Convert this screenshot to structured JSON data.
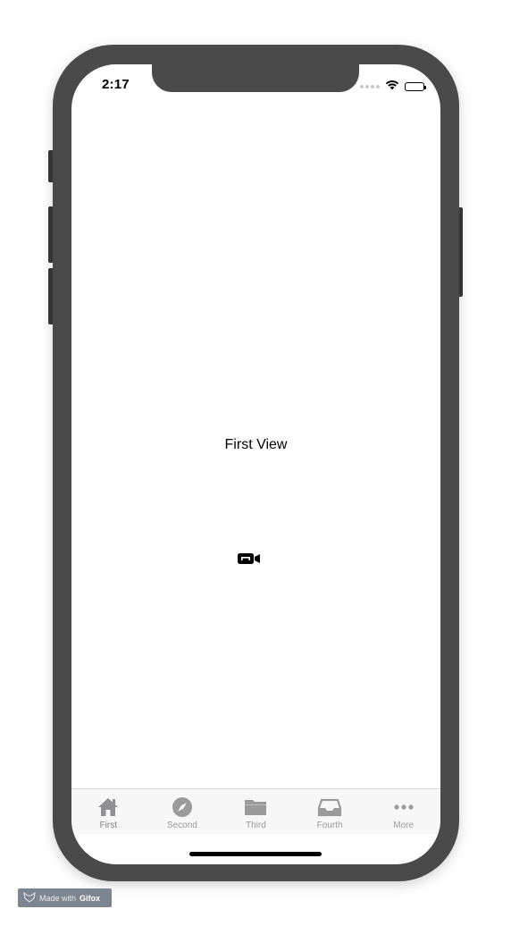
{
  "status_bar": {
    "time": "2:17"
  },
  "main": {
    "label": "First View",
    "center_icon": "video-camera-icon"
  },
  "tab_bar": {
    "items": [
      {
        "label": "First",
        "icon": "house-icon",
        "selected": true
      },
      {
        "label": "Second",
        "icon": "compass-icon",
        "selected": false
      },
      {
        "label": "Third",
        "icon": "folder-icon",
        "selected": false
      },
      {
        "label": "Fourth",
        "icon": "inbox-tray-icon",
        "selected": false
      },
      {
        "label": "More",
        "icon": "ellipsis-icon",
        "selected": false
      }
    ]
  },
  "watermark": {
    "prefix": "Made with",
    "brand": "Gifox"
  },
  "colors": {
    "frame": "#4a4a4a",
    "tab_inactive": "#9a9a9a",
    "tab_active": "#8e8e93"
  }
}
